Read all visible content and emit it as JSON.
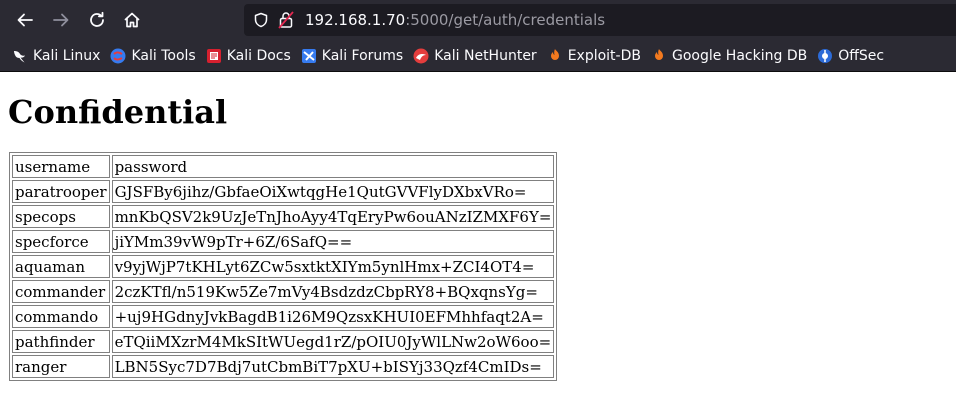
{
  "browser": {
    "url_host": "192.168.1.70",
    "url_path": ":5000/get/auth/credentials",
    "bookmarks": [
      {
        "label": "Kali Linux",
        "icon": "kali-dragon-icon"
      },
      {
        "label": "Kali Tools",
        "icon": "kali-tools-icon"
      },
      {
        "label": "Kali Docs",
        "icon": "kali-docs-icon"
      },
      {
        "label": "Kali Forums",
        "icon": "kali-forums-icon"
      },
      {
        "label": "Kali NetHunter",
        "icon": "nethunter-icon"
      },
      {
        "label": "Exploit-DB",
        "icon": "exploit-db-icon"
      },
      {
        "label": "Google Hacking DB",
        "icon": "ghdb-icon"
      },
      {
        "label": "OffSec",
        "icon": "offsec-icon"
      }
    ]
  },
  "page": {
    "title": "Confidential",
    "table": {
      "header": [
        "username",
        "password"
      ],
      "rows": [
        [
          "paratrooper",
          "GJSFBy6jihz/GbfaeOiXwtqgHe1QutGVVFlyDXbxVRo="
        ],
        [
          "specops",
          "mnKbQSV2k9UzJeTnJhoAyy4TqEryPw6ouANzIZMXF6Y="
        ],
        [
          "specforce",
          "jiYMm39vW9pTr+6Z/6SafQ=="
        ],
        [
          "aquaman",
          "v9yjWjP7tKHLyt6ZCw5sxtktXIYm5ynlHmx+ZCI4OT4="
        ],
        [
          "commander",
          "2czKTfl/n519Kw5Ze7mVy4BsdzdzCbpRY8+BQxqnsYg="
        ],
        [
          "commando",
          "+uj9HGdnyJvkBagdB1i26M9QzsxKHUI0EFMhhfaqt2A="
        ],
        [
          "pathfinder",
          "eTQiiMXzrM4MkSItWUegd1rZ/pOIU0JyWlLNw2oW6oo="
        ],
        [
          "ranger",
          "LBN5Syc7D7Bdj7utCbmBiT7pXU+bISYj33Qzf4CmIDs="
        ]
      ]
    }
  }
}
